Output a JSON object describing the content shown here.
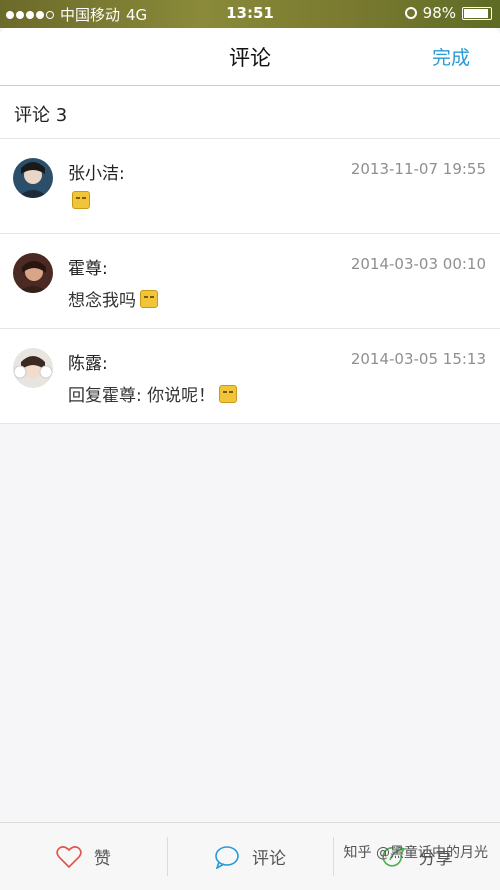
{
  "status_bar": {
    "carrier": "中国移动",
    "network": "4G",
    "time": "13:51",
    "battery": "98%"
  },
  "nav": {
    "title": "评论",
    "done_label": "完成"
  },
  "count_label": "评论 3",
  "comments": [
    {
      "name": "张小洁:",
      "time": "2013-11-07 19:55",
      "text": "",
      "emoji": "smiling-face-icon"
    },
    {
      "name": "霍尊:",
      "time": "2014-03-03 00:10",
      "text": "想念我吗",
      "emoji": "grinning-face-icon"
    },
    {
      "name": "陈露:",
      "time": "2014-03-05 15:13",
      "text": "回复霍尊: 你说呢！",
      "emoji": "smiling-face-icon"
    }
  ],
  "tabs": [
    {
      "label": "赞",
      "icon": "heart-icon",
      "color": "#e0524a"
    },
    {
      "label": "评论",
      "icon": "speech-bubble-icon",
      "color": "#2a9ad6"
    },
    {
      "label": "分享",
      "icon": "share-arrow-icon",
      "color": "#4caf50"
    }
  ],
  "watermark": "知乎 @黑童话中的月光",
  "colors": {
    "accent": "#2a9ad6"
  }
}
